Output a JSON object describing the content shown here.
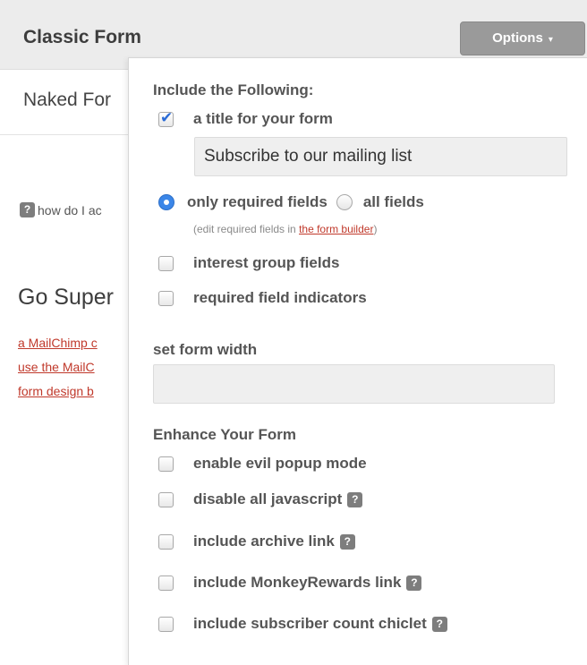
{
  "header": {
    "title": "Classic Form",
    "options_label": "Options",
    "options_caret": "▾"
  },
  "background": {
    "naked_label": "Naked For",
    "help_text": "how do I ac",
    "go_super": "Go Super",
    "links": [
      "a MailChimp c",
      "use the MailC",
      "form design b"
    ]
  },
  "panel": {
    "include_heading": "Include the Following:",
    "title_option": {
      "label": "a title for your form",
      "checked": true
    },
    "title_input_value": "Subscribe to our mailing list",
    "radio_required": {
      "label": "only required fields",
      "selected": true
    },
    "radio_all": {
      "label": "all fields",
      "selected": false
    },
    "edit_note_prefix": "(edit required fields in ",
    "edit_note_link": "the form builder",
    "edit_note_suffix": ")",
    "interest_groups": {
      "label": "interest group fields",
      "checked": false
    },
    "required_indicators": {
      "label": "required field indicators",
      "checked": false
    },
    "width_heading": "set form width",
    "width_input_value": "",
    "enhance_heading": "Enhance Your Form",
    "enhance_options": [
      {
        "label": "enable evil popup mode",
        "checked": false,
        "help": false
      },
      {
        "label": "disable all javascript",
        "checked": false,
        "help": true
      },
      {
        "label": "include archive link",
        "checked": false,
        "help": true
      },
      {
        "label": "include MonkeyRewards link",
        "checked": false,
        "help": true
      },
      {
        "label": "include subscriber count chiclet",
        "checked": false,
        "help": true
      }
    ],
    "help_glyph": "?"
  },
  "colors": {
    "link": "#c0392b",
    "checkmark": "#2a6bd6",
    "radio_selected": "#3b86e8",
    "options_button": "#9a9a9a"
  }
}
